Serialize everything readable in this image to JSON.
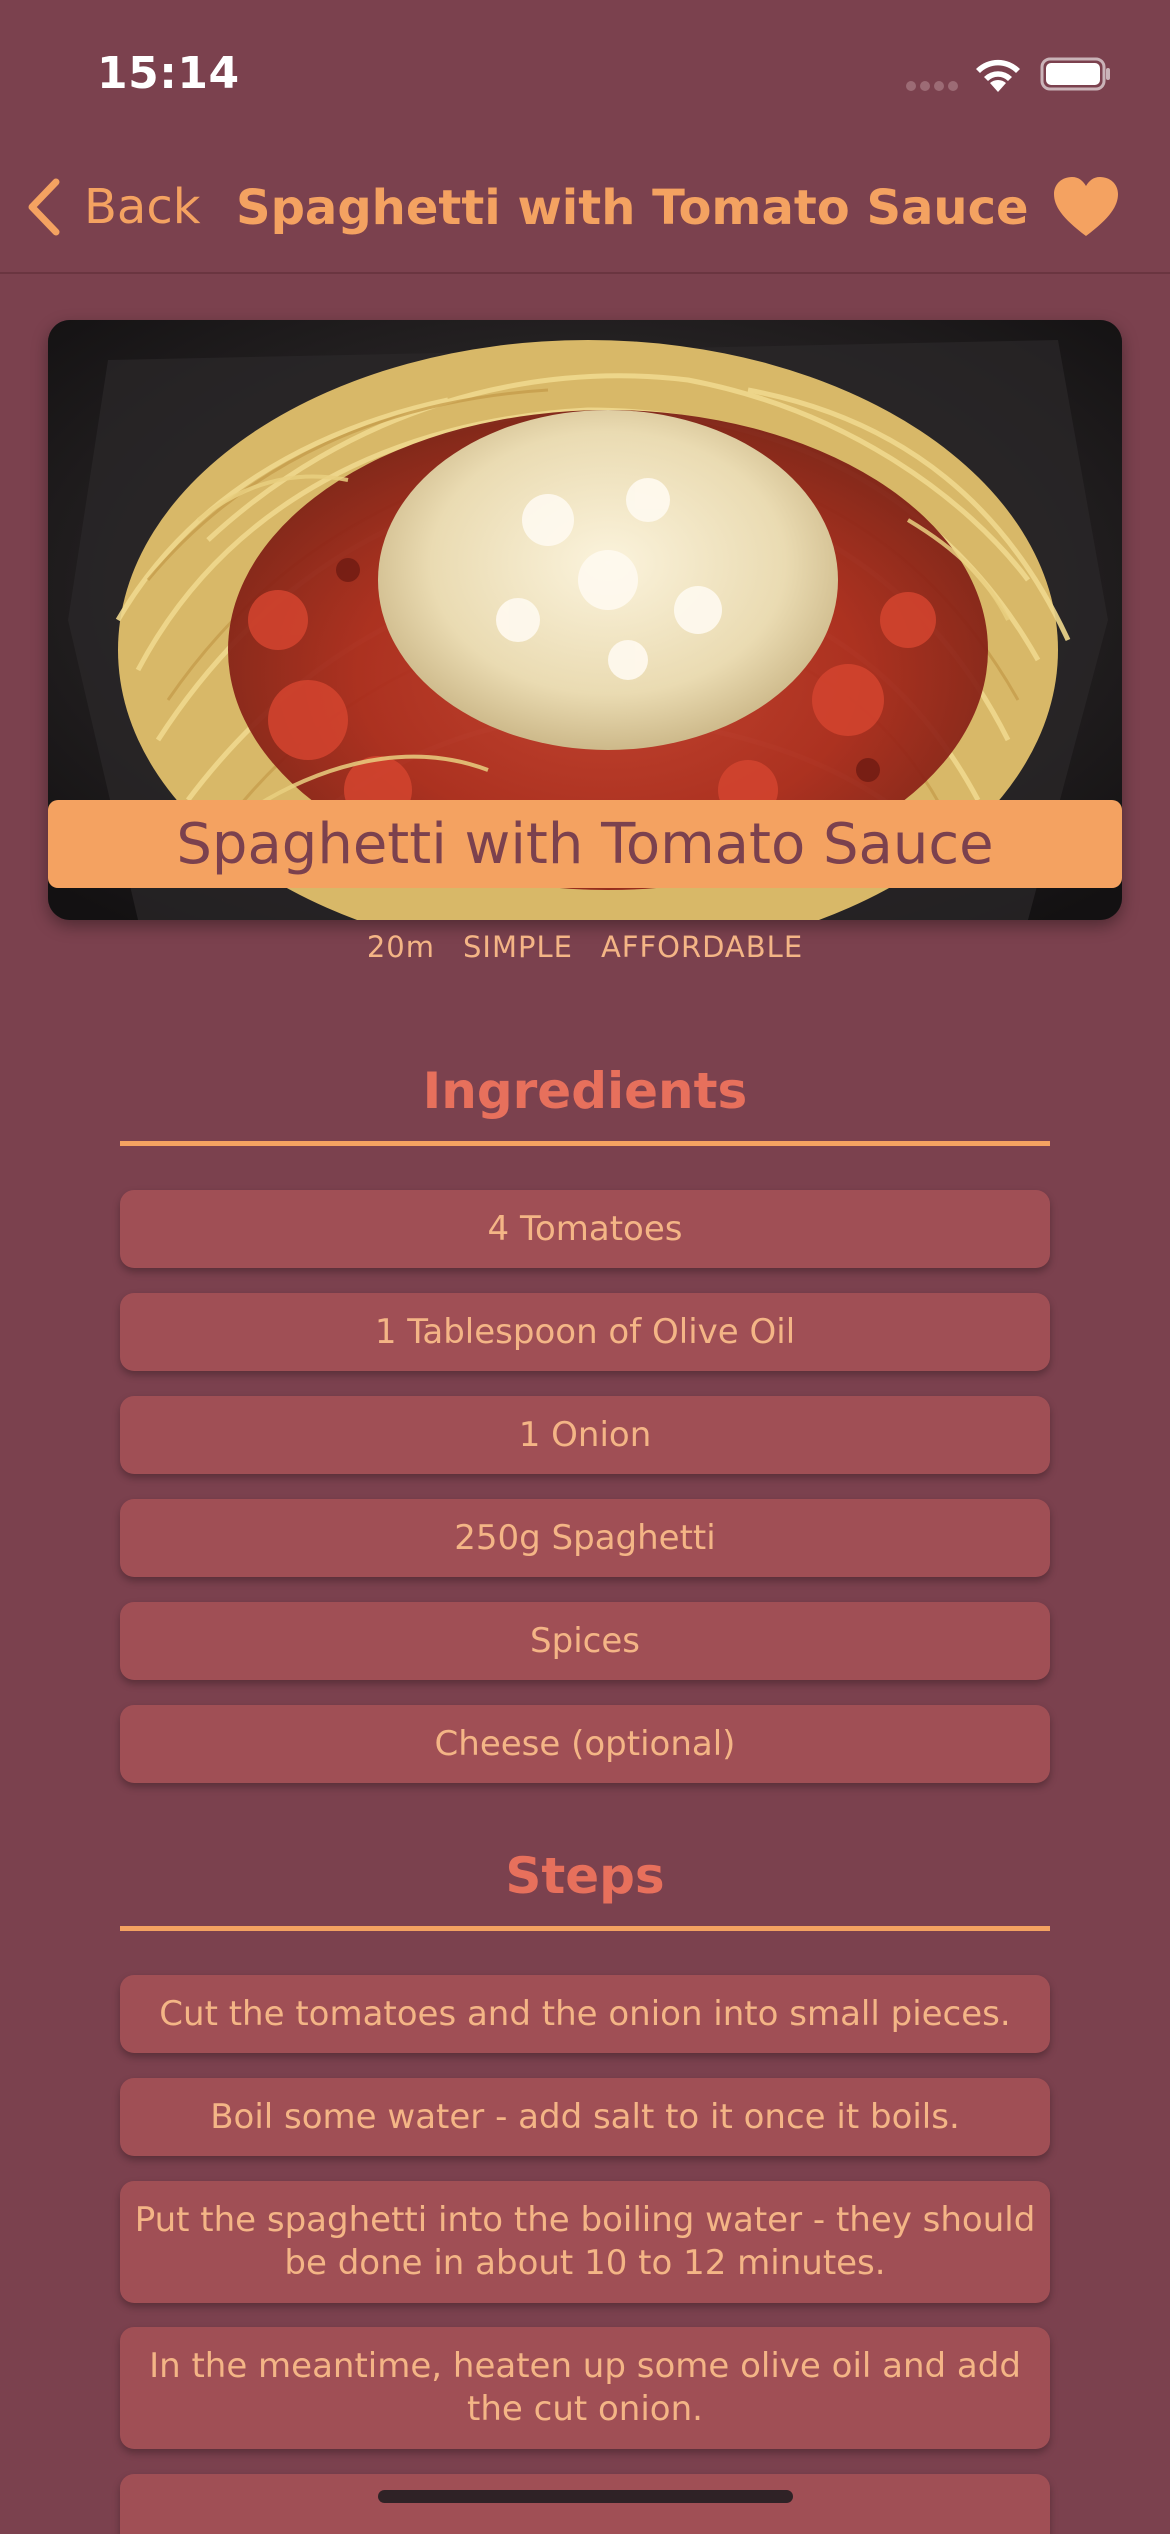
{
  "status_bar": {
    "time": "15:14"
  },
  "nav": {
    "back_label": "Back",
    "title": "Spaghetti with Tomato Sauce",
    "favorite_icon": "heart-icon"
  },
  "meal": {
    "title": "Spaghetti with Tomato Sauce",
    "duration": "20m",
    "complexity": "SIMPLE",
    "affordability": "AFFORDABLE"
  },
  "ingredients": {
    "title": "Ingredients",
    "items": [
      "4 Tomatoes",
      "1 Tablespoon of Olive Oil",
      "1 Onion",
      "250g Spaghetti",
      "Spices",
      "Cheese (optional)"
    ]
  },
  "steps": {
    "title": "Steps",
    "items": [
      "Cut the tomatoes and the onion into small pieces.",
      "Boil some water - add salt to it once it boils.",
      "Put the spaghetti into the boiling water - they should be done in about 10 to 12 minutes.",
      "In the meantime, heaten up some olive oil and add the cut onion."
    ]
  },
  "colors": {
    "background": "#7b414e",
    "accent": "#f4a261",
    "section_title": "#e7705c",
    "pill": "#a04f55"
  }
}
